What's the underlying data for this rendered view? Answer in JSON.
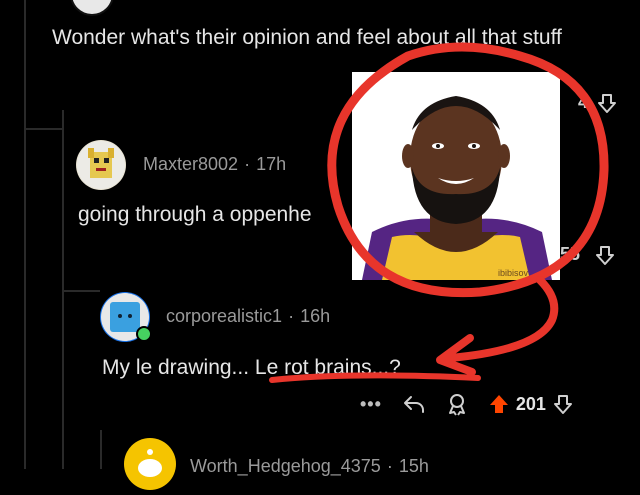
{
  "post": {
    "text": "Wonder what's their opinion and feel about all that stuff",
    "partial_vote_count": "4"
  },
  "comment1": {
    "username": "Maxter8002",
    "separator": "·",
    "time": "17h",
    "text": "going through a oppenhe",
    "partial_vote_count": "55"
  },
  "comment2": {
    "username": "corporealistic1",
    "separator": "·",
    "time": "16h",
    "text_prefix": "My le drawing... ",
    "text_highlight": "Le rot brains...?",
    "actions": {
      "more_label": "•••",
      "vote_count": "201"
    }
  },
  "comment3": {
    "username": "Worth_Hedgehog_4375",
    "separator": "·",
    "time": "15h"
  },
  "photo": {
    "watermark": "ibibisov"
  },
  "icons": {
    "downvote": "arrow-down-icon",
    "upvote": "arrow-up-icon",
    "reply": "reply-icon",
    "award": "award-icon",
    "more": "more-icon"
  },
  "colors": {
    "background": "#000000",
    "upvote": "#ff4500",
    "annotation": "#e8352b",
    "online": "#46d160"
  }
}
